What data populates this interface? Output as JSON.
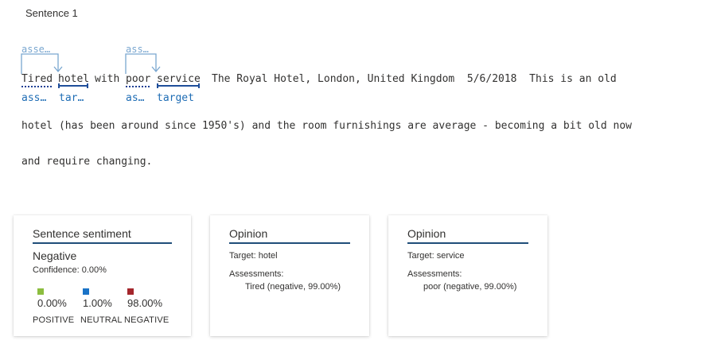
{
  "sentence_title": "Sentence 1",
  "tokens": {
    "tired": "Tired",
    "hotel": "hotel",
    "with": "with",
    "poor": "poor",
    "service": "service",
    "rest": "The Royal Hotel, London, United Kingdom  5/6/2018  This is an old"
  },
  "relation_labels": {
    "top_1": "asse…",
    "top_2": "ass…",
    "bottom_tired": "ass…",
    "bottom_hotel": "tar…",
    "bottom_poor": "as…",
    "bottom_service": "target"
  },
  "text_lines": [
    "hotel (has been around since 1950's) and the room furnishings are average - becoming a bit old now",
    "and require changing."
  ],
  "sentiment_card": {
    "title": "Sentence sentiment",
    "label": "Negative",
    "confidence": "Confidence: 0.00%",
    "scores": [
      {
        "value": "0.00%",
        "label": "POSITIVE",
        "color": "#8cbd3f"
      },
      {
        "value": "1.00%",
        "label": "NEUTRAL",
        "color": "#1a73c7"
      },
      {
        "value": "98.00%",
        "label": "NEGATIVE",
        "color": "#a4262c"
      }
    ]
  },
  "opinion_cards": [
    {
      "title": "Opinion",
      "target_label": "Target:",
      "target_value": "hotel",
      "assessments_label": "Assessments:",
      "assessment": "Tired (negative, 99.00%)"
    },
    {
      "title": "Opinion",
      "target_label": "Target:",
      "target_value": "service",
      "assessments_label": "Assessments:",
      "assessment": "poor (negative, 99.00%)"
    }
  ],
  "colors": {
    "accent": "#1f4e79",
    "relation_line": "#7aa7d0",
    "label_blue": "#1f6db5"
  }
}
